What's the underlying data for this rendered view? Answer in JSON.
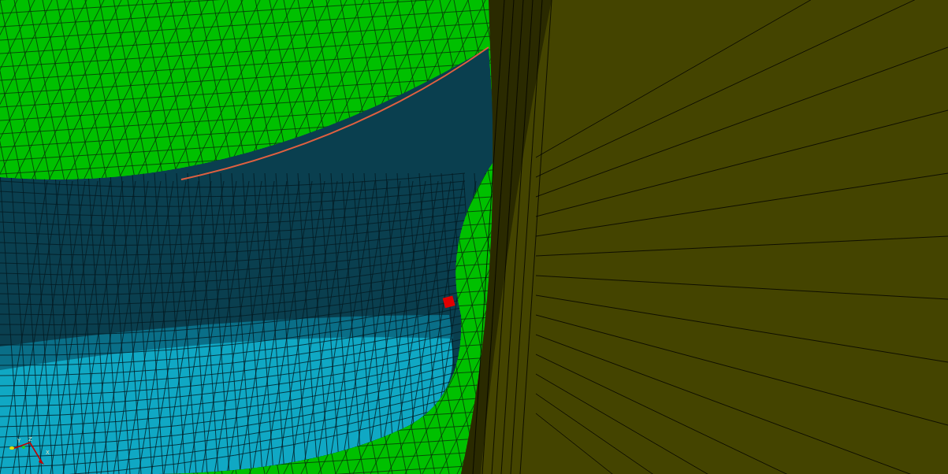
{
  "viewport": {
    "axis_triad": {
      "labels": [
        "Y",
        "Z",
        "X"
      ]
    }
  }
}
